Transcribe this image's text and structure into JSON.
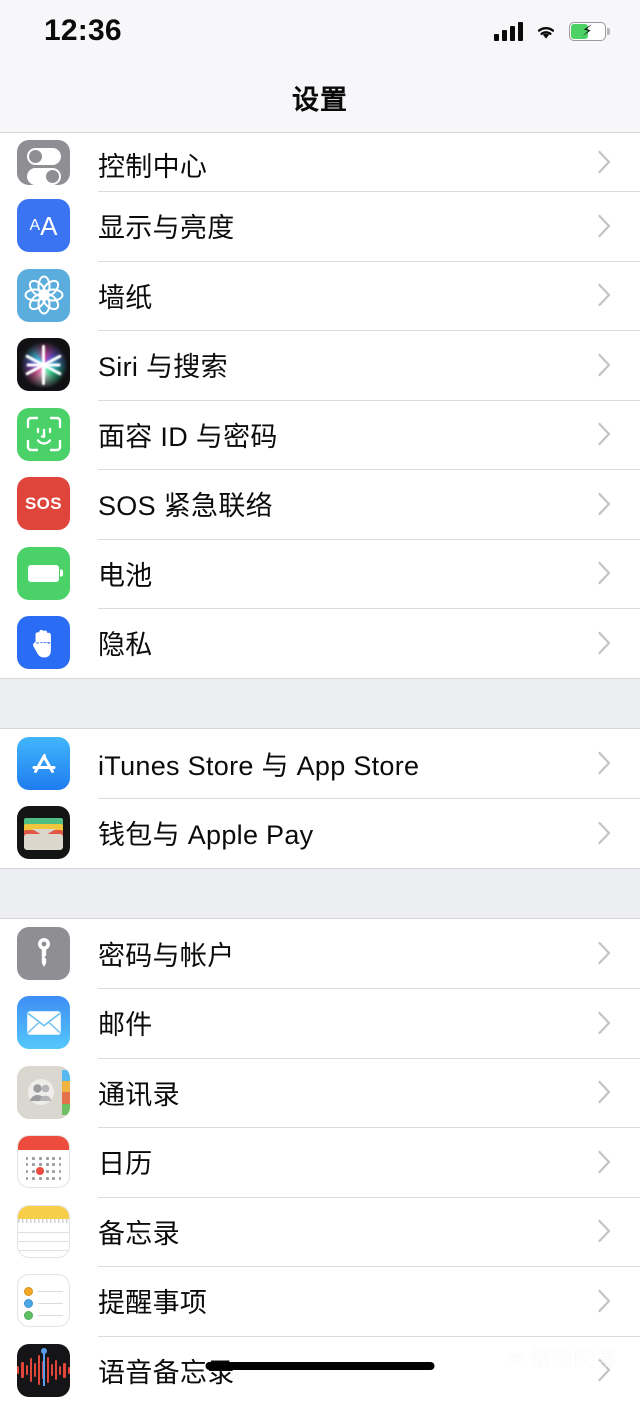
{
  "statusbar": {
    "time": "12:36",
    "signal_icon": "cellular-signal-icon",
    "wifi_icon": "wifi-icon",
    "battery_icon": "battery-charging-icon",
    "battery_level_percent": 45,
    "battery_charging": true
  },
  "navbar": {
    "title": "设置"
  },
  "colors": {
    "page_background": "#eceef1",
    "row_background": "#ffffff",
    "separator": "#dcdcdf",
    "chevron": "#c4c4c7",
    "label_text": "#0b0b0b",
    "navbar_background": "#f7f7f9"
  },
  "sections": [
    {
      "name": "system-section",
      "rows": [
        {
          "label": "控制中心",
          "icon": "control-center-icon",
          "clipped": true
        },
        {
          "label": "显示与亮度",
          "icon": "display-brightness-icon"
        },
        {
          "label": "墙纸",
          "icon": "wallpaper-icon"
        },
        {
          "label": "Siri 与搜索",
          "icon": "siri-icon"
        },
        {
          "label": "面容 ID 与密码",
          "icon": "face-id-icon"
        },
        {
          "label": "SOS 紧急联络",
          "icon": "emergency-sos-icon"
        },
        {
          "label": "电池",
          "icon": "battery-settings-icon"
        },
        {
          "label": "隐私",
          "icon": "privacy-icon"
        }
      ]
    },
    {
      "name": "store-section",
      "rows": [
        {
          "label": "iTunes Store 与 App Store",
          "icon": "app-store-icon"
        },
        {
          "label": "钱包与 Apple Pay",
          "icon": "wallet-icon"
        }
      ]
    },
    {
      "name": "apps-section",
      "rows": [
        {
          "label": "密码与帐户",
          "icon": "passwords-accounts-icon"
        },
        {
          "label": "邮件",
          "icon": "mail-icon"
        },
        {
          "label": "通讯录",
          "icon": "contacts-icon"
        },
        {
          "label": "日历",
          "icon": "calendar-icon"
        },
        {
          "label": "备忘录",
          "icon": "notes-icon"
        },
        {
          "label": "提醒事项",
          "icon": "reminders-icon"
        },
        {
          "label": "语音备忘录",
          "icon": "voice-memos-icon"
        }
      ]
    }
  ],
  "chevron_icon": "chevron-right-icon",
  "watermark": {
    "logo": "∞",
    "text": "悟空问答"
  },
  "home_indicator": "home-indicator-bar"
}
